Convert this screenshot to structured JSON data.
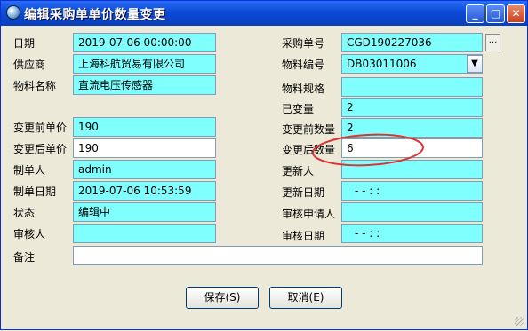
{
  "window": {
    "title": "编辑采购单单价数量变更"
  },
  "form": {
    "date_label": "日期",
    "date_value": "2019-07-06 00:00:00",
    "order_no_label": "采购单号",
    "order_no_value": "CGD190227036",
    "supplier_label": "供应商",
    "supplier_value": "上海科航贸易有限公司",
    "material_code_label": "物料编号",
    "material_code_value": "DB03011006",
    "material_name_label": "物料名称",
    "material_name_value": "直流电压传感器",
    "material_spec_label": "物料规格",
    "material_spec_value": "",
    "changed_label": "已变量",
    "changed_value": "2",
    "price_before_label": "变更前单价",
    "price_before_value": "190",
    "qty_before_label": "变更前数量",
    "qty_before_value": "2",
    "price_after_label": "变更后单价",
    "price_after_value": "190",
    "qty_after_label": "变更后数量",
    "qty_after_value": "6",
    "creator_label": "制单人",
    "creator_value": "admin",
    "updater_label": "更新人",
    "updater_value": "",
    "created_date_label": "制单日期",
    "created_date_value": "2019-07-06 10:53:59",
    "updated_date_label": "更新日期",
    "updated_date_value": "- -   : :",
    "status_label": "状态",
    "status_value": "编辑中",
    "audit_applicant_label": "审核申请人",
    "audit_applicant_value": "",
    "auditor_label": "审核人",
    "auditor_value": "",
    "audit_date_label": "审核日期",
    "audit_date_value": "- -   : :",
    "remark_label": "备注",
    "remark_value": ""
  },
  "buttons": {
    "save": "保存(S)",
    "cancel": "取消(E)"
  },
  "annotation": {
    "color": "#dd3333"
  }
}
